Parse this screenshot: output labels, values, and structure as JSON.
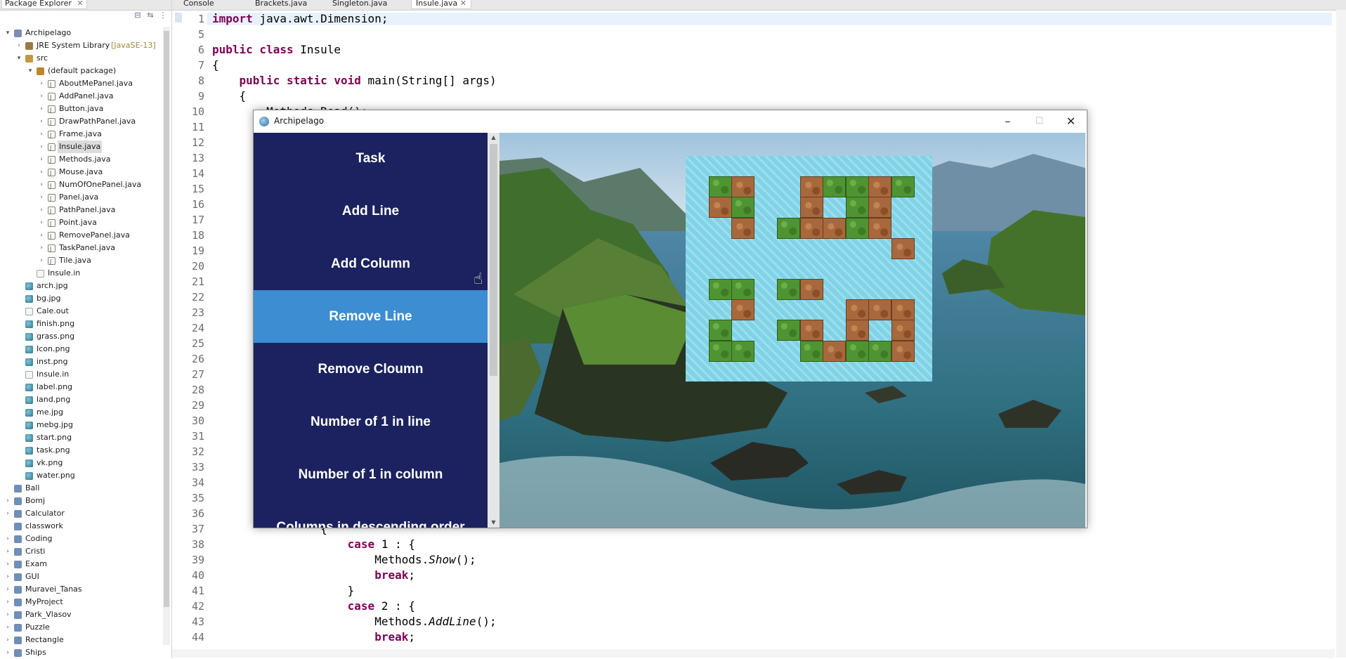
{
  "explorer": {
    "tab_label": "Package Explorer",
    "tree": [
      {
        "label": "Archipelago",
        "indent": 0,
        "arrow": "▾",
        "icon": "proj"
      },
      {
        "label": "JRE System Library",
        "extra": "[JavaSE-13]",
        "indent": 1,
        "arrow": "›",
        "icon": "jre"
      },
      {
        "label": "src",
        "indent": 1,
        "arrow": "▾",
        "icon": "src"
      },
      {
        "label": "(default package)",
        "indent": 2,
        "arrow": "▾",
        "icon": "pkg"
      },
      {
        "label": "AboutMePanel.java",
        "indent": 3,
        "arrow": "›",
        "icon": "java"
      },
      {
        "label": "AddPanel.java",
        "indent": 3,
        "arrow": "›",
        "icon": "java"
      },
      {
        "label": "Button.java",
        "indent": 3,
        "arrow": "›",
        "icon": "java"
      },
      {
        "label": "DrawPathPanel.java",
        "indent": 3,
        "arrow": "›",
        "icon": "java"
      },
      {
        "label": "Frame.java",
        "indent": 3,
        "arrow": "›",
        "icon": "java"
      },
      {
        "label": "Insule.java",
        "indent": 3,
        "arrow": "›",
        "icon": "java",
        "selected": true
      },
      {
        "label": "Methods.java",
        "indent": 3,
        "arrow": "›",
        "icon": "java"
      },
      {
        "label": "Mouse.java",
        "indent": 3,
        "arrow": "›",
        "icon": "java"
      },
      {
        "label": "NumOfOnePanel.java",
        "indent": 3,
        "arrow": "›",
        "icon": "java"
      },
      {
        "label": "Panel.java",
        "indent": 3,
        "arrow": "›",
        "icon": "java"
      },
      {
        "label": "PathPanel.java",
        "indent": 3,
        "arrow": "›",
        "icon": "java"
      },
      {
        "label": "Point.java",
        "indent": 3,
        "arrow": "›",
        "icon": "java"
      },
      {
        "label": "RemovePanel.java",
        "indent": 3,
        "arrow": "›",
        "icon": "java"
      },
      {
        "label": "TaskPanel.java",
        "indent": 3,
        "arrow": "›",
        "icon": "java"
      },
      {
        "label": "Tile.java",
        "indent": 3,
        "arrow": "›",
        "icon": "java"
      },
      {
        "label": "Insule.in",
        "indent": 2,
        "arrow": "",
        "icon": "file"
      },
      {
        "label": "arch.jpg",
        "indent": 1,
        "arrow": "",
        "icon": "img"
      },
      {
        "label": "bg.jpg",
        "indent": 1,
        "arrow": "",
        "icon": "img"
      },
      {
        "label": "Cale.out",
        "indent": 1,
        "arrow": "",
        "icon": "file"
      },
      {
        "label": "finish.png",
        "indent": 1,
        "arrow": "",
        "icon": "img"
      },
      {
        "label": "grass.png",
        "indent": 1,
        "arrow": "",
        "icon": "img"
      },
      {
        "label": "Icon.png",
        "indent": 1,
        "arrow": "",
        "icon": "img"
      },
      {
        "label": "inst.png",
        "indent": 1,
        "arrow": "",
        "icon": "img"
      },
      {
        "label": "Insule.in",
        "indent": 1,
        "arrow": "",
        "icon": "file"
      },
      {
        "label": "label.png",
        "indent": 1,
        "arrow": "",
        "icon": "img"
      },
      {
        "label": "land.png",
        "indent": 1,
        "arrow": "",
        "icon": "img"
      },
      {
        "label": "me.jpg",
        "indent": 1,
        "arrow": "",
        "icon": "img"
      },
      {
        "label": "mebg.jpg",
        "indent": 1,
        "arrow": "",
        "icon": "img"
      },
      {
        "label": "start.png",
        "indent": 1,
        "arrow": "",
        "icon": "img"
      },
      {
        "label": "task.png",
        "indent": 1,
        "arrow": "",
        "icon": "img"
      },
      {
        "label": "vk.png",
        "indent": 1,
        "arrow": "",
        "icon": "img"
      },
      {
        "label": "water.png",
        "indent": 1,
        "arrow": "",
        "icon": "img"
      },
      {
        "label": "Ball",
        "indent": 0,
        "arrow": "",
        "icon": "fold"
      },
      {
        "label": "Bomj",
        "indent": 0,
        "arrow": "›",
        "icon": "fold"
      },
      {
        "label": "Calculator",
        "indent": 0,
        "arrow": "›",
        "icon": "fold"
      },
      {
        "label": "classwork",
        "indent": 0,
        "arrow": "",
        "icon": "fold"
      },
      {
        "label": "Coding",
        "indent": 0,
        "arrow": "›",
        "icon": "fold"
      },
      {
        "label": "Cristi",
        "indent": 0,
        "arrow": "›",
        "icon": "fold"
      },
      {
        "label": "Exam",
        "indent": 0,
        "arrow": "›",
        "icon": "fold"
      },
      {
        "label": "GUI",
        "indent": 0,
        "arrow": "›",
        "icon": "fold"
      },
      {
        "label": "Muravei_Tanas",
        "indent": 0,
        "arrow": "›",
        "icon": "fold"
      },
      {
        "label": "MyProject",
        "indent": 0,
        "arrow": "›",
        "icon": "fold"
      },
      {
        "label": "Park_Vlasov",
        "indent": 0,
        "arrow": "›",
        "icon": "fold"
      },
      {
        "label": "Puzzle",
        "indent": 0,
        "arrow": "›",
        "icon": "fold"
      },
      {
        "label": "Rectangle",
        "indent": 0,
        "arrow": "›",
        "icon": "fold"
      },
      {
        "label": "Ships",
        "indent": 0,
        "arrow": "›",
        "icon": "fold"
      }
    ]
  },
  "editor": {
    "tabs": [
      {
        "label": "Console",
        "active": false
      },
      {
        "label": "Brackets.java",
        "active": false
      },
      {
        "label": "Singleton.java",
        "active": false
      },
      {
        "label": "Insule.java",
        "active": true
      }
    ],
    "lines": [
      {
        "n": "1",
        "html": "<span class='kw'>import</span> java.awt.Dimension;"
      },
      {
        "n": "5",
        "html": ""
      },
      {
        "n": "6",
        "html": "<span class='kw'>public class</span> Insule"
      },
      {
        "n": "7",
        "html": "{"
      },
      {
        "n": "8",
        "html": "    <span class='kw'>public static void</span> main(String[] args)"
      },
      {
        "n": "9",
        "html": "    {"
      },
      {
        "n": "10",
        "html": "        Methods.Read();"
      },
      {
        "n": "11",
        "html": ""
      },
      {
        "n": "12",
        "html": ""
      },
      {
        "n": "13",
        "html": ""
      },
      {
        "n": "14",
        "html": ""
      },
      {
        "n": "15",
        "html": ""
      },
      {
        "n": "16",
        "html": ""
      },
      {
        "n": "17",
        "html": ""
      },
      {
        "n": "18",
        "html": ""
      },
      {
        "n": "19",
        "html": ""
      },
      {
        "n": "20",
        "html": ""
      },
      {
        "n": "21",
        "html": ""
      },
      {
        "n": "22",
        "html": ""
      },
      {
        "n": "23",
        "html": ""
      },
      {
        "n": "24",
        "html": ""
      },
      {
        "n": "25",
        "html": ""
      },
      {
        "n": "26",
        "html": ""
      },
      {
        "n": "27",
        "html": ""
      },
      {
        "n": "28",
        "html": ""
      },
      {
        "n": "29",
        "html": ""
      },
      {
        "n": "30",
        "html": ""
      },
      {
        "n": "31",
        "html": ""
      },
      {
        "n": "32",
        "html": ""
      },
      {
        "n": "33",
        "html": ""
      },
      {
        "n": "34",
        "html": ""
      },
      {
        "n": "35",
        "html": ""
      },
      {
        "n": "36",
        "html": ""
      },
      {
        "n": "37",
        "html": "                {"
      },
      {
        "n": "38",
        "html": "                    <span class='kw'>case</span> 1 : {"
      },
      {
        "n": "39",
        "html": "                        Methods.<span class='it'>Show</span>();"
      },
      {
        "n": "40",
        "html": "                        <span class='kw'>break</span>;"
      },
      {
        "n": "41",
        "html": "                    }"
      },
      {
        "n": "42",
        "html": "                    <span class='kw'>case</span> 2 : {"
      },
      {
        "n": "43",
        "html": "                        Methods.<span class='it'>AddLine</span>();"
      },
      {
        "n": "44",
        "html": "                        <span class='kw'>break</span>;"
      }
    ]
  },
  "window": {
    "title": "Archipelago",
    "controls": {
      "minimize": "–",
      "maximize": "☐",
      "close": "✕"
    },
    "menu": [
      {
        "label": "Task",
        "active": false
      },
      {
        "label": "Add Line",
        "active": false
      },
      {
        "label": "Add Column",
        "active": false
      },
      {
        "label": "Remove Line",
        "active": true
      },
      {
        "label": "Remove Cloumn",
        "active": false
      },
      {
        "label": "Number of 1 in line",
        "active": false
      },
      {
        "label": "Number of 1 in column",
        "active": false
      },
      {
        "label": "Columns in descending order",
        "active": false
      }
    ],
    "grid": [
      "..........",
      ".GL..LGGLG",
      ".LG..L.GL.",
      "..L.GLLGL.",
      ".........L",
      "..........",
      ".GG.GL....",
      "..L....LLL",
      ".G..GL.L.L",
      ".GG..GLGGL",
      ".........."
    ]
  }
}
